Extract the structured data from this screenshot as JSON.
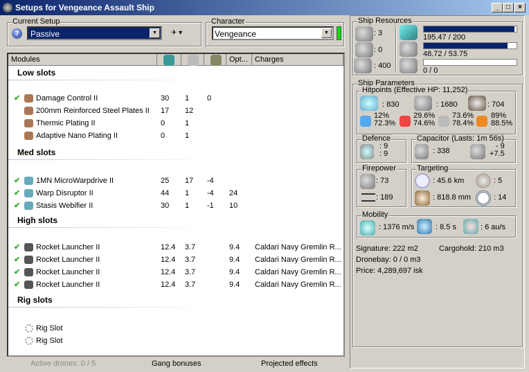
{
  "window": {
    "title": "Setups for Vengeance Assault Ship"
  },
  "setup": {
    "label": "Current Setup",
    "value": "Passive"
  },
  "character": {
    "label": "Character",
    "value": "Vengeance",
    "status_color": "#00e000"
  },
  "columns": [
    "Modules",
    "Opt...",
    "Charges"
  ],
  "sections": [
    {
      "title": "Low slots",
      "rows": [
        {
          "name": "Damage Control II",
          "cpu": "30",
          "pg": "1",
          "cap": "0",
          "opt": "",
          "charge": "",
          "active": true
        },
        {
          "name": "200mm Reinforced Steel Plates II",
          "cpu": "17",
          "pg": "12",
          "cap": "",
          "opt": "",
          "charge": "",
          "active": false
        },
        {
          "name": "Thermic Plating II",
          "cpu": "0",
          "pg": "1",
          "cap": "",
          "opt": "",
          "charge": "",
          "active": false
        },
        {
          "name": "Adaptive Nano Plating II",
          "cpu": "0",
          "pg": "1",
          "cap": "",
          "opt": "",
          "charge": "",
          "active": false
        }
      ]
    },
    {
      "title": "Med slots",
      "rows": [
        {
          "name": "1MN MicroWarpdrive II",
          "cpu": "25",
          "pg": "17",
          "cap": "-4",
          "opt": "",
          "charge": "",
          "active": true
        },
        {
          "name": "Warp Disruptor II",
          "cpu": "44",
          "pg": "1",
          "cap": "-4",
          "opt": "24",
          "charge": "",
          "active": true
        },
        {
          "name": "Stasis Webifier II",
          "cpu": "30",
          "pg": "1",
          "cap": "-1",
          "opt": "10",
          "charge": "",
          "active": true
        }
      ]
    },
    {
      "title": "High slots",
      "rows": [
        {
          "name": "Rocket Launcher II",
          "cpu": "12.4",
          "pg": "3.7",
          "cap": "",
          "opt": "9.4",
          "charge": "Caldari Navy Gremlin R...",
          "active": true
        },
        {
          "name": "Rocket Launcher II",
          "cpu": "12.4",
          "pg": "3.7",
          "cap": "",
          "opt": "9.4",
          "charge": "Caldari Navy Gremlin R...",
          "active": true
        },
        {
          "name": "Rocket Launcher II",
          "cpu": "12.4",
          "pg": "3.7",
          "cap": "",
          "opt": "9.4",
          "charge": "Caldari Navy Gremlin R...",
          "active": true
        },
        {
          "name": "Rocket Launcher II",
          "cpu": "12.4",
          "pg": "3.7",
          "cap": "",
          "opt": "9.4",
          "charge": "Caldari Navy Gremlin R...",
          "active": true
        }
      ]
    },
    {
      "title": "Rig slots",
      "rows": [
        {
          "name": "Rig Slot",
          "cpu": "",
          "pg": "",
          "cap": "",
          "opt": "",
          "charge": "",
          "active": false,
          "empty": true
        },
        {
          "name": "Rig Slot",
          "cpu": "",
          "pg": "",
          "cap": "",
          "opt": "",
          "charge": "",
          "active": false,
          "empty": true
        }
      ]
    }
  ],
  "footer": {
    "drones": "Active drones: 0 / 5",
    "gang": "Gang bonuses",
    "projected": "Projected effects"
  },
  "resources": {
    "label": "Ship Resources",
    "turrets": ": 3",
    "launchers": ": 0",
    "calibration": ": 400",
    "cpu": "195.47 / 200",
    "cpu_frac": 0.977,
    "pg": "48.72 / 53.75",
    "pg_frac": 0.906,
    "drone_bw": "0 / 0",
    "drone_frac": 0
  },
  "params": {
    "label": "Ship Parameters",
    "hp_label": "Hitpoints (Effective HP: 11,252)",
    "shield": ": 830",
    "armor": ": 1680",
    "hull": ": 704",
    "resists": [
      [
        "12%",
        "72.3%"
      ],
      [
        "29.6%",
        "74.6%"
      ],
      [
        "73.6%",
        "78.4%"
      ],
      [
        "89%",
        "88.5%"
      ]
    ],
    "defence_label": "Defence",
    "def1": ": 9",
    "def2": ": 9",
    "cap_label": "Capacitor (Lasts: 1m 56s)",
    "cap": ": 338",
    "cap_use": "- 9",
    "cap_regen": "+7.5",
    "fire_label": "Firepower",
    "dps": ": 73",
    "volley": ": 189",
    "target_label": "Targeting",
    "range": ": 45.6 km",
    "max_targets": ": 5",
    "scan": ": 818.8 mm",
    "sensor": ": 14",
    "mob_label": "Mobility",
    "speed": ": 1376 m/s",
    "align": ": 8.5 s",
    "warp": ": 6 au/s",
    "signature": "Signature: 222 m2",
    "cargo": "Cargohold: 210 m3",
    "dronebay": "Dronebay: 0 / 0 m3",
    "price": "Price: 4,289,697 isk"
  }
}
